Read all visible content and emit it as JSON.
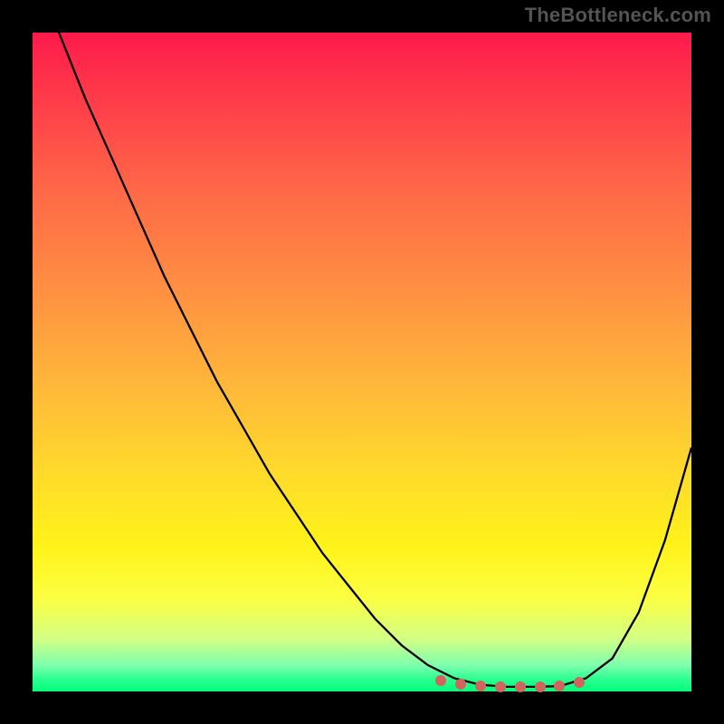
{
  "attribution": "TheBottleneck.com",
  "colors": {
    "curve_stroke": "#000000",
    "dot_fill": "#d2635d",
    "frame_bg": "#000000",
    "gradient_stops": [
      "#ff1a4b",
      "#ff3b4a",
      "#ff6847",
      "#ff8d42",
      "#ffb33b",
      "#ffd82c",
      "#fff31a",
      "#fbff43",
      "#d2ff84",
      "#7fffad",
      "#26ff8f",
      "#04ff7a"
    ]
  },
  "chart_data": {
    "type": "line",
    "title": "",
    "xlabel": "",
    "ylabel": "",
    "xlim": [
      0,
      100
    ],
    "ylim": [
      0,
      100
    ],
    "x": [
      0,
      4,
      8,
      12,
      16,
      20,
      24,
      28,
      32,
      36,
      40,
      44,
      48,
      52,
      56,
      60,
      64,
      68,
      72,
      76,
      80,
      84,
      88,
      92,
      96,
      100
    ],
    "values": [
      110,
      100,
      90,
      81,
      72,
      63,
      55,
      47,
      40,
      33,
      27,
      21,
      16,
      11,
      7,
      4,
      2,
      1,
      0.7,
      0.7,
      0.8,
      2,
      5,
      12,
      23,
      37
    ],
    "sweet_spot_x": [
      62,
      65,
      68,
      71,
      74,
      77,
      80,
      83
    ],
    "sweet_spot_y": [
      1.6,
      1.1,
      0.8,
      0.7,
      0.7,
      0.7,
      0.8,
      1.4
    ]
  }
}
